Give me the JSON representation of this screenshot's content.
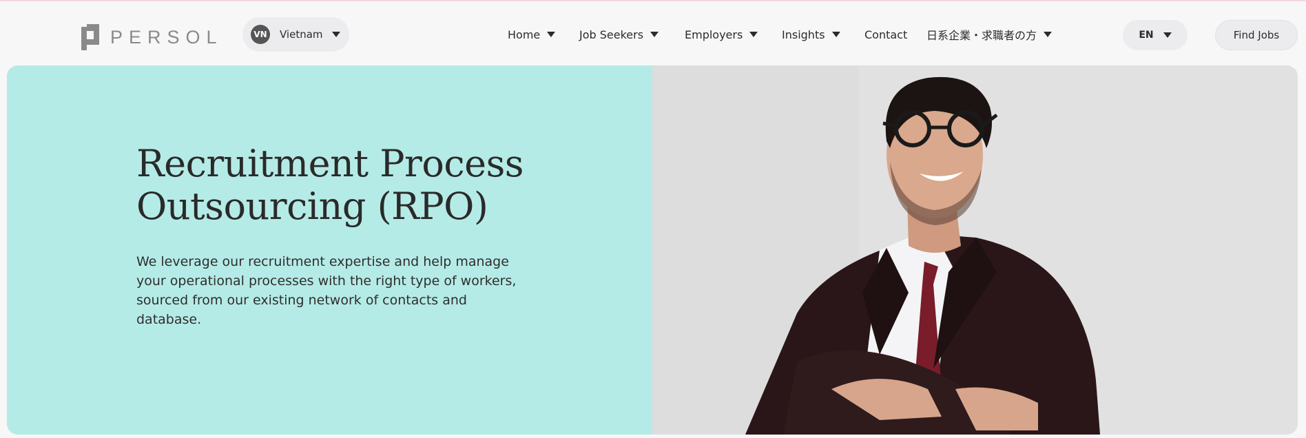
{
  "header": {
    "logo_text": "PERSOL",
    "country": {
      "code": "VN",
      "name": "Vietnam"
    },
    "nav": [
      {
        "label": "Home",
        "has_dropdown": true
      },
      {
        "label": "Job Seekers",
        "has_dropdown": true
      },
      {
        "label": "Employers",
        "has_dropdown": true
      },
      {
        "label": "Insights",
        "has_dropdown": true
      },
      {
        "label": "Contact",
        "has_dropdown": false
      },
      {
        "label": "日系企業・求職者の方",
        "has_dropdown": true
      }
    ],
    "language": "EN",
    "find_jobs_label": "Find Jobs"
  },
  "hero": {
    "title_line1": "Recruitment Process",
    "title_line2": "Outsourcing (RPO)",
    "description": "We leverage our recruitment expertise and help manage your operational processes with the right type of workers, sourced from our existing network of contacts and database.",
    "background_color": "#b5ebe6"
  },
  "icons": {
    "dropdown": "caret-down-icon",
    "logo": "persol-logo-mark"
  }
}
